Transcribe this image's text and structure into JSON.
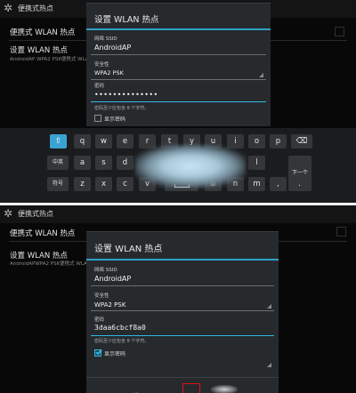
{
  "screen1": {
    "actionbar": {
      "title": "便携式热点"
    },
    "background": {
      "row_title": "便携式 WLAN 热点",
      "setup_title": "设置 WLAN 热点",
      "setup_sub": "AndroidAP WPA2 PSK便携式 WLAN"
    },
    "dialog": {
      "title": "设置 WLAN 热点",
      "ssid_label": "网络 SSID",
      "ssid_value": "AndroidAP",
      "security_label": "安全性",
      "security_value": "WPA2 PSK",
      "password_label": "密码",
      "password_value": "••••••••••••••",
      "hint": "密码至少应包含 8 个字符。",
      "show_password": "显示密码",
      "show_password_checked": false
    },
    "keyboard": {
      "row1": [
        "q",
        "w",
        "e",
        "r",
        "t",
        "y",
        "u",
        "i",
        "o",
        "p"
      ],
      "row2_left": [
        "a",
        "s",
        "d"
      ],
      "row2_right": [
        "l"
      ],
      "row3_left": [
        "z",
        "x",
        "c",
        "v"
      ],
      "row3_right": [
        "b",
        "n",
        "m"
      ],
      "shift_icon": "⇧",
      "backspace_icon": "⌫",
      "lang_key": "中英",
      "sym_key": "符号",
      "enter_key": "下一个",
      "comma": ",",
      "period": "."
    }
  },
  "screen2": {
    "actionbar": {
      "title": "便携式热点"
    },
    "background": {
      "row_title": "便携式 WLAN 热点",
      "setup_title": "设置 WLAN 热点",
      "setup_sub": "AndroidAPWPA2 PSK便携式 WLA"
    },
    "dialog": {
      "title": "设置 WLAN 热点",
      "ssid_label": "网络 SSID",
      "ssid_value": "AndroidAP",
      "security_label": "安全性",
      "security_value": "WPA2 PSK",
      "password_label": "密码",
      "password_value": "3daa6cbcf8a0",
      "hint": "密码至少应包含 8 个字符。",
      "show_password": "显示密码",
      "show_password_checked": true,
      "cancel": "取消"
    }
  },
  "colors": {
    "accent": "#33b5e5",
    "highlight": "#e01010",
    "dialog_bg": "#272a2d"
  }
}
